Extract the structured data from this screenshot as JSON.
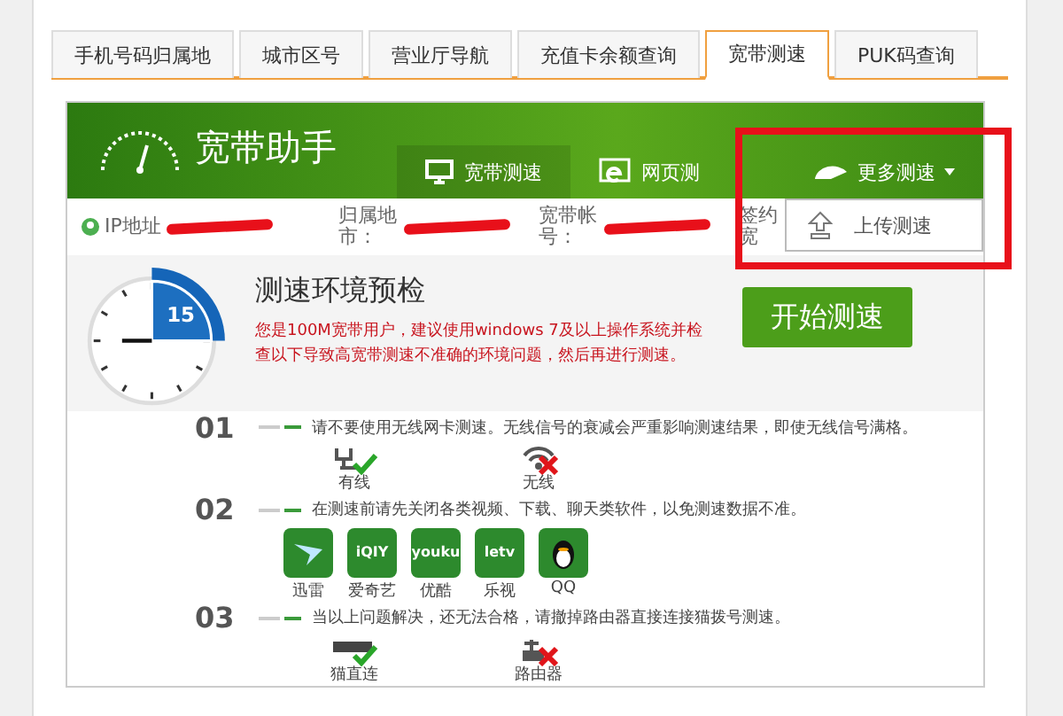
{
  "tabs": [
    {
      "label": "手机号码归属地",
      "selected": false
    },
    {
      "label": "城市区号",
      "selected": false
    },
    {
      "label": "营业厅导航",
      "selected": false
    },
    {
      "label": "充值卡余额查询",
      "selected": false
    },
    {
      "label": "宽带测速",
      "selected": true
    },
    {
      "label": "PUK码查询",
      "selected": false
    }
  ],
  "header": {
    "title": "宽带助手",
    "nav": [
      {
        "label": "宽带测速",
        "kind": "monitor",
        "selected": true
      },
      {
        "label": "网页测",
        "kind": "browser",
        "selected": false
      }
    ],
    "more": {
      "label": "更多测速",
      "expanded": true,
      "items": [
        "上传测速"
      ]
    }
  },
  "info": {
    "fields": [
      {
        "label": "IP地址"
      },
      {
        "label": "归属地市："
      },
      {
        "label": "宽带帐号："
      },
      {
        "label": "签约宽"
      }
    ]
  },
  "precheck": {
    "clock": "15",
    "title": "测速环境预检",
    "note": "您是100M宽带用户，建议使用windows 7及以上操作系统并检查以下导致高宽带测速不准确的环境问题，然后再进行测速。",
    "button": "开始测速"
  },
  "steps": [
    {
      "number": "01",
      "text": "请不要使用无线网卡测速。无线信号的衰减会严重影响测速结果，即使无线信号满格。",
      "items": [
        {
          "label": "有线",
          "kind": "wired",
          "ok": true
        },
        {
          "label": "无线",
          "kind": "wireless",
          "ok": false
        }
      ]
    },
    {
      "number": "02",
      "text": "在测速前请先关闭各类视频、下载、聊天类软件，以免测速数据不准。",
      "apps": [
        {
          "label": "迅雷",
          "kind": "bird"
        },
        {
          "label": "爱奇艺",
          "kind": "iqiyi",
          "logo": "iQIY"
        },
        {
          "label": "优酷",
          "kind": "youku",
          "logo": "youku"
        },
        {
          "label": "乐视",
          "kind": "letv",
          "logo": "letv"
        },
        {
          "label": "QQ",
          "kind": "penguin"
        }
      ]
    },
    {
      "number": "03",
      "text": "当以上问题解决，还无法合格，请撤掉路由器直接连接猫拨号测速。",
      "items": [
        {
          "label": "猫直连",
          "kind": "modem",
          "ok": true
        },
        {
          "label": "路由器",
          "kind": "router",
          "ok": false
        }
      ]
    }
  ]
}
